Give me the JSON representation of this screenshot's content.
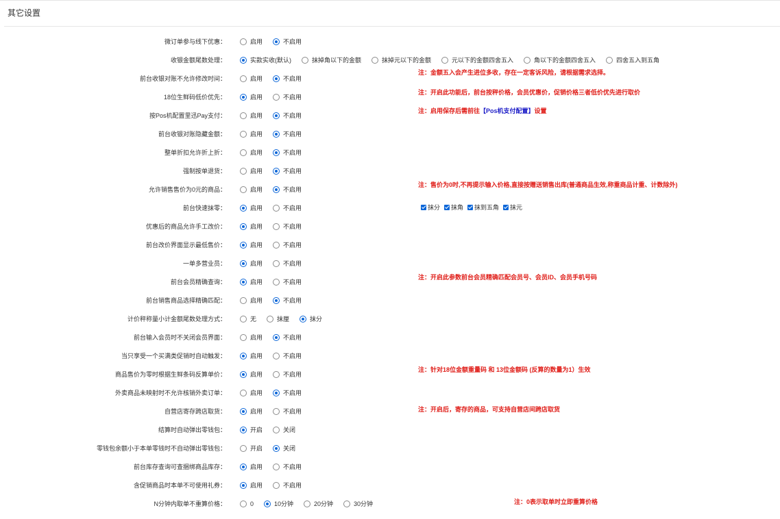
{
  "panel": {
    "title": "其它设置"
  },
  "settings": [
    {
      "label": "微订单参与线下优惠：",
      "options": [
        "启用",
        "不启用"
      ],
      "selected": 1
    },
    {
      "label": "收银金额尾数处理：",
      "options": [
        "实款实收(默认)",
        "抹掉角以下的金额",
        "抹掉元以下的金额",
        "元以下的金额四舍五入",
        "角以下的金额四舍五入",
        "四舍五入到五角"
      ],
      "selected": 0
    },
    {
      "label": "前台收银对账不允许修改时间：",
      "options": [
        "启用",
        "不启用"
      ],
      "selected": 1
    },
    {
      "label": "18位生鲜码低价优先：",
      "options": [
        "启用",
        "不启用"
      ],
      "selected": 0
    },
    {
      "label": "按Pos机配置里迅Pay支付：",
      "options": [
        "启用",
        "不启用"
      ],
      "selected": 1
    },
    {
      "label": "前台收银对账隐藏金额：",
      "options": [
        "启用",
        "不启用"
      ],
      "selected": 1
    },
    {
      "label": "整单折扣允许折上折：",
      "options": [
        "启用",
        "不启用"
      ],
      "selected": 1
    },
    {
      "label": "强制按单退货：",
      "options": [
        "启用",
        "不启用"
      ],
      "selected": 1
    },
    {
      "label": "允许销售售价为0元的商品：",
      "options": [
        "启用",
        "不启用"
      ],
      "selected": 1
    },
    {
      "label": "前台快速抹零：",
      "options": [
        "启用",
        "不启用"
      ],
      "selected": 0
    },
    {
      "label": "优惠后的商品允许手工改价：",
      "options": [
        "启用",
        "不启用"
      ],
      "selected": 0
    },
    {
      "label": "前台改价界面显示最低售价：",
      "options": [
        "启用",
        "不启用"
      ],
      "selected": 0
    },
    {
      "label": "一单多营业员：",
      "options": [
        "启用",
        "不启用"
      ],
      "selected": 0
    },
    {
      "label": "前台会员精确查询：",
      "options": [
        "启用",
        "不启用"
      ],
      "selected": 0
    },
    {
      "label": "前台销售商品选择精确匹配：",
      "options": [
        "启用",
        "不启用"
      ],
      "selected": 1
    },
    {
      "label": "计价秤称量小计金额尾数处理方式：",
      "options": [
        "无",
        "抹厘",
        "抹分"
      ],
      "selected": 2
    },
    {
      "label": "前台输入会员时不关闭会员界面：",
      "options": [
        "启用",
        "不启用"
      ],
      "selected": 1
    },
    {
      "label": "当只享受一个买满类促销时自动触发：",
      "options": [
        "启用",
        "不启用"
      ],
      "selected": 0
    },
    {
      "label": "商品售价为零时根据生鲜条码反算单价：",
      "options": [
        "启用",
        "不启用"
      ],
      "selected": 0
    },
    {
      "label": "外卖商品未映射时不允许核销外卖订单：",
      "options": [
        "启用",
        "不启用"
      ],
      "selected": 1
    },
    {
      "label": "自营店寄存跨店取货：",
      "options": [
        "启用",
        "不启用"
      ],
      "selected": 0
    },
    {
      "label": "结算时自动弹出零钱包：",
      "options": [
        "开启",
        "关闭"
      ],
      "selected": 0
    },
    {
      "label": "零钱包余额小于本单零钱时不自动弹出零钱包：",
      "options": [
        "开启",
        "关闭"
      ],
      "selected": 1
    },
    {
      "label": "前台库存查询可查捆绑商品库存：",
      "options": [
        "启用",
        "不启用"
      ],
      "selected": 0
    },
    {
      "label": "含促销商品时本单不可使用礼券：",
      "options": [
        "启用",
        "不启用"
      ],
      "selected": 0
    },
    {
      "label": "N分钟内取单不重算价格：",
      "options": [
        "0",
        "10分钟",
        "20分钟",
        "30分钟"
      ],
      "selected": 1
    }
  ],
  "notes": {
    "rounding": "注：金额五入会产生进位多收，存在一定客诉风险，请根据需求选择。",
    "lowest_price": "注：开启此功能后，前台按秤价格，会员优惠价，促销价格三者低价优先进行取价",
    "pos_pay_prefix": "注：启用保存后需前往",
    "pos_pay_link": "【Pos机支付配置】",
    "pos_pay_suffix": "设置",
    "zero_price": "注：售价为0时,不再提示输入价格,直接按赠送销售出库(普通商品生效,称重商品计重、计数除外)",
    "member_query": "注：开启此参数前台会员精确匹配会员号、会员ID、会员手机号码",
    "fresh_code": "注：针对18位金额重量码 和 13位金额码 (反算的数量为1）生效",
    "cross_store": "注：开启后，寄存的商品，可支持自营店间跨店取货",
    "reprice": "注：0表示取单时立即重算价格"
  },
  "quick_zero_checks": [
    "抹分",
    "抹角",
    "抹到五角",
    "抹元"
  ]
}
